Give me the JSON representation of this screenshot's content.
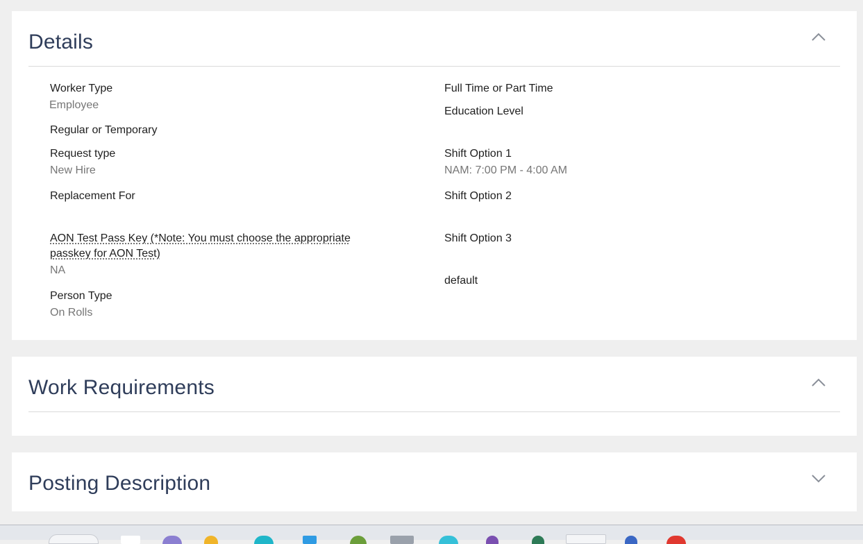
{
  "details": {
    "title": "Details",
    "left": [
      {
        "label": "Worker Type",
        "value": "Employee"
      },
      {
        "label": "Regular or Temporary",
        "value": ""
      },
      {
        "label": "Request type",
        "value": "New Hire"
      },
      {
        "label": "Replacement For",
        "value": ""
      },
      {
        "label": "AON Test Pass Key (*Note: You must choose the appropriate passkey for AON Test)",
        "value": "NA"
      },
      {
        "label": "Person Type",
        "value": "On Rolls"
      }
    ],
    "right": [
      {
        "label": "Full Time or Part Time",
        "value": ""
      },
      {
        "label": "Education Level",
        "value": ""
      },
      {
        "label": "Shift Option 1",
        "value": "NAM: 7:00 PM - 4:00 AM"
      },
      {
        "label": "Shift Option 2",
        "value": ""
      },
      {
        "label": "Shift Option 3",
        "value": ""
      },
      {
        "label": "default",
        "value": ""
      }
    ]
  },
  "work_requirements": {
    "title": "Work Requirements"
  },
  "posting_description": {
    "title": "Posting Description"
  },
  "icons": {
    "details_toggle": "chevron-up-icon",
    "work_requirements_toggle": "chevron-up-icon",
    "posting_description_toggle": "chevron-down-icon"
  },
  "colors": {
    "background": "#efefef",
    "card": "#ffffff",
    "title": "#2f3d5a",
    "label": "#1f1f1f",
    "value": "#767676"
  }
}
